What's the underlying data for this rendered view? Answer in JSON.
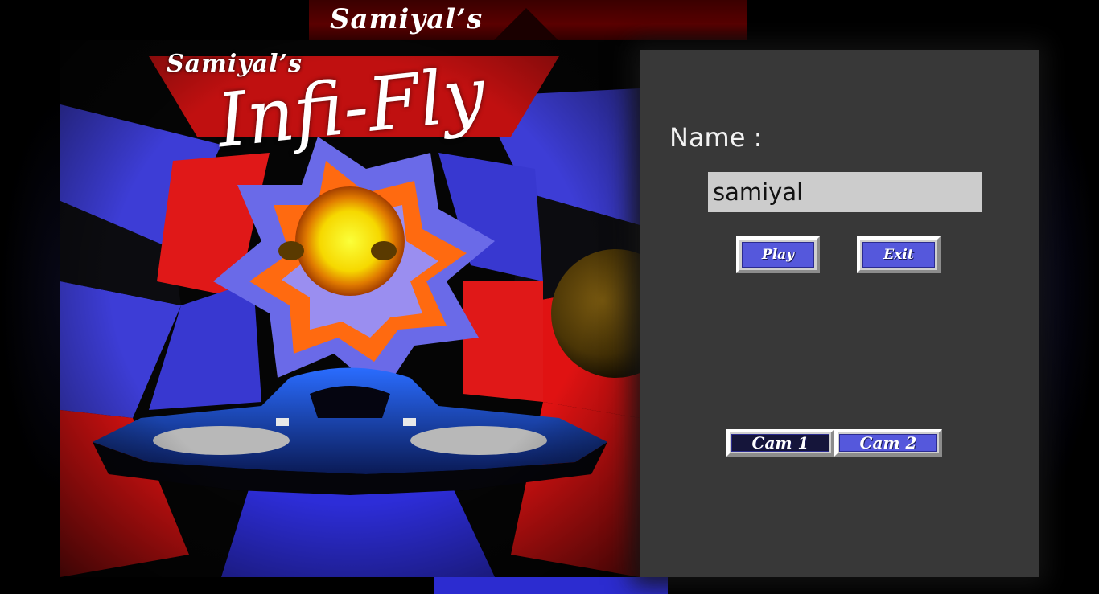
{
  "background": {
    "top_banner_text": "Samiyal’s"
  },
  "poster": {
    "subtitle": "Samiyal’s",
    "title": "Infi-Fly"
  },
  "menu": {
    "name_label": "Name :",
    "name_value": "samiyal",
    "play_label": "Play",
    "exit_label": "Exit",
    "cam1_label": "Cam 1",
    "cam2_label": "Cam 2",
    "selected_camera": "Cam 1"
  },
  "colors": {
    "panel_bg": "#383838",
    "button_face": "#5558dc",
    "button_selected_face": "#15153a",
    "input_bg": "#cccccc"
  }
}
